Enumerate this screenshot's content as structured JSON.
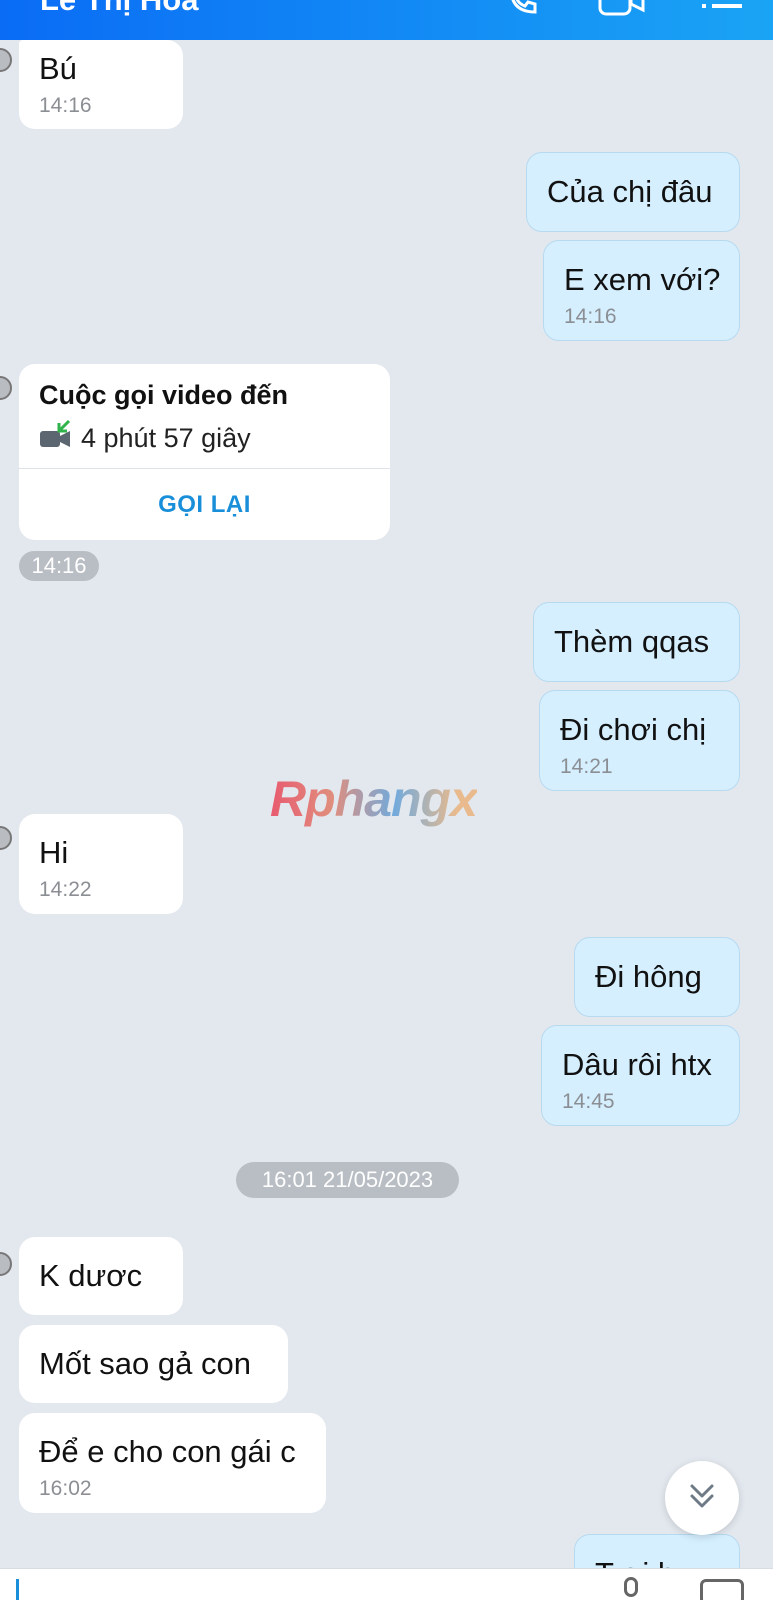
{
  "header": {
    "title": "Lê Thị Hoa",
    "icons": [
      "phone-icon",
      "video-call-icon",
      "list-menu-icon"
    ],
    "bg_color": "#0a6cf5"
  },
  "messages": {
    "m1": {
      "text": "Bú",
      "time": "14:16"
    },
    "m2": {
      "text": "Của chị đâu"
    },
    "m3": {
      "text": "E xem với?",
      "time": "14:16"
    },
    "call": {
      "title": "Cuộc gọi video đến",
      "duration": "4 phút 57 giây",
      "action": "GỌI LẠI",
      "time": "14:16"
    },
    "m4": {
      "text": "Thèm qqas"
    },
    "m5": {
      "text": "Đi chơi chị",
      "time": "14:21"
    },
    "m6": {
      "text": "Hi",
      "time": "14:22"
    },
    "m7": {
      "text": "Đi hông"
    },
    "m8": {
      "text": "Dâu rôi htx",
      "time": "14:45"
    },
    "date_divider": "16:01 21/05/2023",
    "m9": {
      "text": "K dươc"
    },
    "m10": {
      "text": "Mốt sao gả con"
    },
    "m11": {
      "text": "Để e cho con gái c",
      "time": "16:02"
    },
    "m12": {
      "text": "T ơi h..."
    }
  },
  "watermark": "Rphangx",
  "colors": {
    "incoming_bubble": "#ffffff",
    "outgoing_bubble": "#d5efff",
    "background": "#e3e8ef",
    "accent": "#1a8fd9"
  }
}
